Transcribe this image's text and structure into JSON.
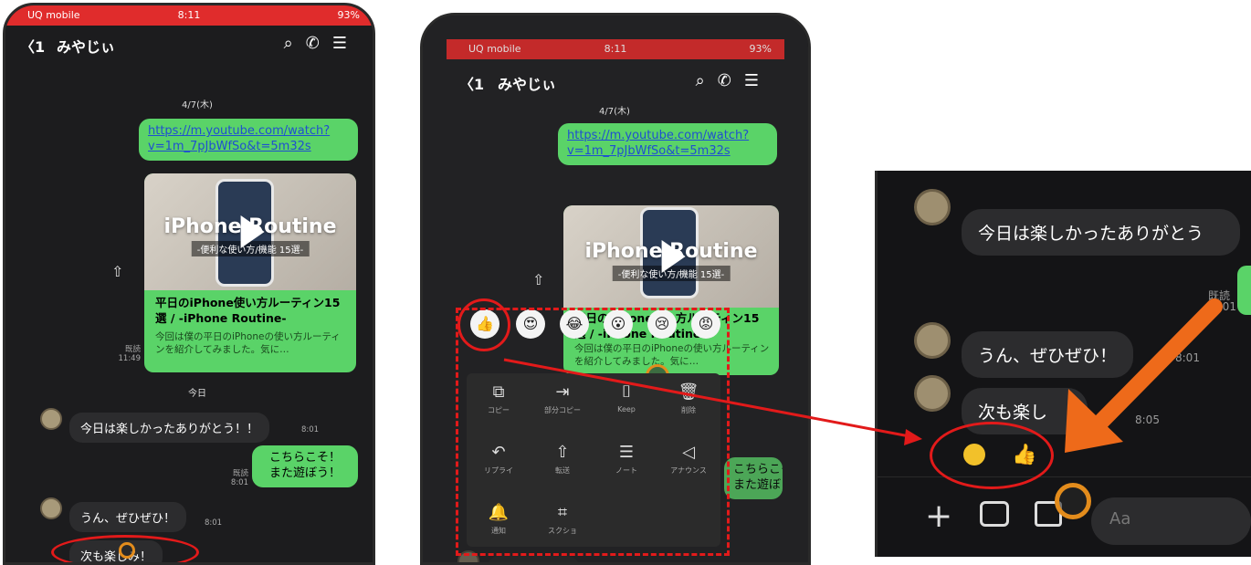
{
  "status": {
    "carrier": "UQ mobile",
    "time": "8:11",
    "battery": "93%"
  },
  "header": {
    "back_count": "1",
    "chat_name": "みやじぃ"
  },
  "chat": {
    "date_label": "4/7(木)",
    "link_text": "https://m.youtube.com/watch?v=1m_7pJbWfSo&t=5m32s",
    "thumb_title": "iPhone Routine",
    "thumb_subtitle": "-便利な使い方/機能 15選-",
    "card_title": "平日のiPhone使い方ルーティン15選 / -iPhone Routine-",
    "card_desc": "今回は僕の平日のiPhoneの使い方ルーティンを紹介してみました。気に…",
    "read_label": "既読",
    "sent_time": "11:49",
    "today_label": "今日",
    "msg1": "今日は楽しかったありがとう！！",
    "msg1_time": "8:01",
    "msg2_line1": "こちらこそ！",
    "msg2_line2": "また遊ぼう！",
    "msg2_read": "既読",
    "msg2_time": "8:01",
    "msg3": "うん、ぜひぜひ！",
    "msg3_time": "8:01",
    "msg4": "次も楽しみ！",
    "msg4_time": "8:05"
  },
  "menu": {
    "items": [
      {
        "icon": "copy-icon",
        "glyph": "⧉",
        "label": "コピー"
      },
      {
        "icon": "partial-copy-icon",
        "glyph": "⇥",
        "label": "部分コピー"
      },
      {
        "icon": "keep-icon",
        "glyph": "⌷",
        "label": "Keep"
      },
      {
        "icon": "trash-icon",
        "glyph": "🗑",
        "label": "削除"
      },
      {
        "icon": "reply-icon",
        "glyph": "↶",
        "label": "リプライ"
      },
      {
        "icon": "forward-icon",
        "glyph": "⇧",
        "label": "転送"
      },
      {
        "icon": "note-icon",
        "glyph": "☰",
        "label": "ノート"
      },
      {
        "icon": "announce-icon",
        "glyph": "◁",
        "label": "アナウンス"
      },
      {
        "icon": "bell-icon",
        "glyph": "🔔",
        "label": "通知"
      },
      {
        "icon": "screenshot-icon",
        "glyph": "⌗",
        "label": "スクショ"
      }
    ]
  },
  "reactions": [
    "👍",
    "😍",
    "😂",
    "😮",
    "😢",
    "😡"
  ],
  "zoom": {
    "msg1": "今日は楽しかったありがとう",
    "read": "既読",
    "msg3": "うん、ぜひぜひ！",
    "msg3_time": "8:01",
    "msg4": "次も楽し",
    "msg4_time": "8:05",
    "input_placeholder": "Aa"
  },
  "colors": {
    "bubble_green": "#5ad368",
    "status_red": "#e02c2c",
    "highlight_red": "#e21a1a",
    "arrow_orange": "#ee6a1a"
  }
}
